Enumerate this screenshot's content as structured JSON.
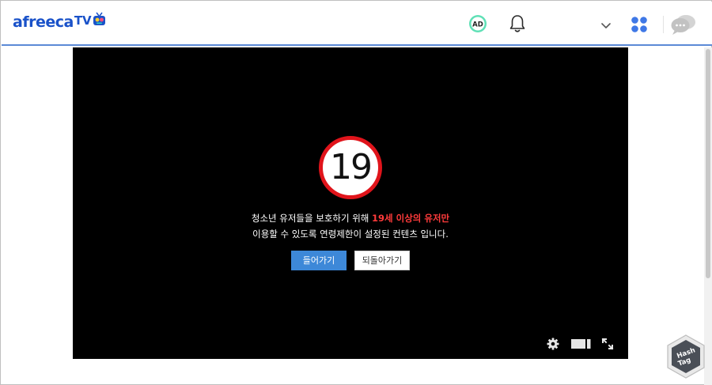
{
  "header": {
    "logo_text": "afreeca",
    "logo_tv": "TV",
    "ad_label": "AD",
    "icons": [
      "ad-icon",
      "bell-icon",
      "chevron-down-icon",
      "apps-grid-icon",
      "chat-bubble-icon"
    ]
  },
  "player": {
    "age_rating": "19",
    "message_line1_prefix": "청소년 유저들을 보호하기 위해 ",
    "message_line1_highlight": "19세 이상의 유저만",
    "message_line2": "이용할 수 있도록 연령제한이 설정된 컨텐츠 입니다.",
    "enter_button": "들어가기",
    "back_button": "되돌아가기",
    "controls": [
      "gear-icon",
      "theater-mode-icon",
      "fullscreen-icon"
    ]
  },
  "watermark": {
    "line1": "Hash",
    "line2": "Tag"
  },
  "colors": {
    "brand_blue": "#1a52c9",
    "header_border": "#5b8ad6",
    "age_red": "#e0141b",
    "highlight_red": "#ff3b3b",
    "enter_button_bg": "#3d88d8"
  }
}
